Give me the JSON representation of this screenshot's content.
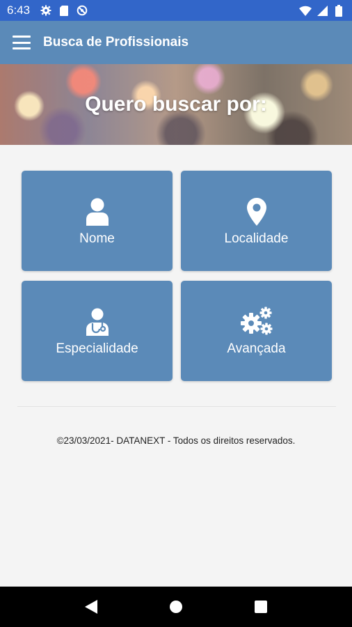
{
  "status_bar": {
    "time": "6:43",
    "left_icons": [
      "settings-icon",
      "sd-card-icon",
      "no-sync-icon"
    ],
    "right_icons": [
      "wifi-icon",
      "signal-icon",
      "battery-icon"
    ],
    "color": "#3266c9"
  },
  "app_bar": {
    "title": "Busca de Profissionais",
    "menu_icon": "hamburger-menu-icon",
    "color": "#5b8ab8"
  },
  "banner": {
    "heading": "Quero buscar por:"
  },
  "tiles": [
    {
      "label": "Nome",
      "icon": "person-icon"
    },
    {
      "label": "Localidade",
      "icon": "map-pin-icon"
    },
    {
      "label": "Especialidade",
      "icon": "doctor-icon"
    },
    {
      "label": "Avançada",
      "icon": "gears-icon"
    }
  ],
  "footer": {
    "text": "©23/03/2021- DATANEXT - Todos os direitos reservados."
  },
  "nav_bar": {
    "buttons": [
      "back-icon",
      "home-icon",
      "recents-icon"
    ]
  }
}
